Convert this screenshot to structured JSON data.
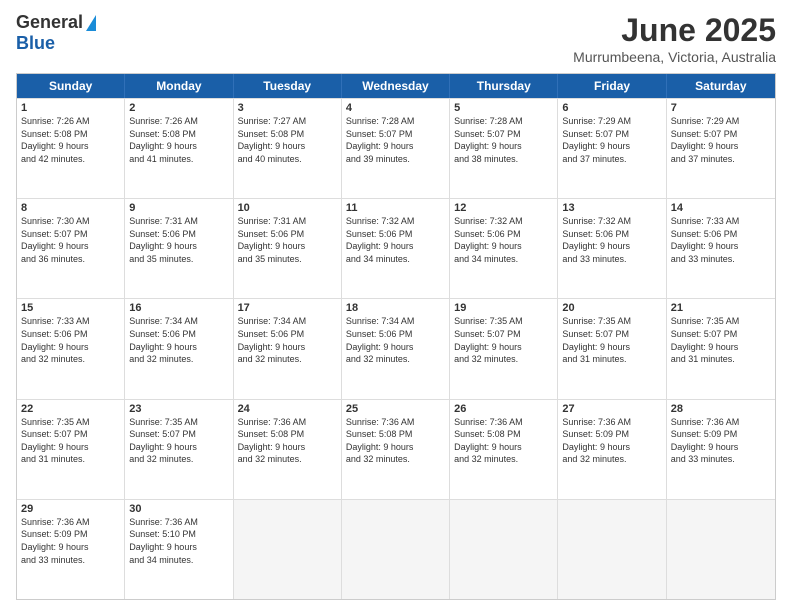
{
  "header": {
    "logo_general": "General",
    "logo_blue": "Blue",
    "title": "June 2025",
    "subtitle": "Murrumbeena, Victoria, Australia"
  },
  "calendar": {
    "days": [
      "Sunday",
      "Monday",
      "Tuesday",
      "Wednesday",
      "Thursday",
      "Friday",
      "Saturday"
    ],
    "rows": [
      [
        {
          "num": "1",
          "info": "Sunrise: 7:26 AM\nSunset: 5:08 PM\nDaylight: 9 hours\nand 42 minutes."
        },
        {
          "num": "2",
          "info": "Sunrise: 7:26 AM\nSunset: 5:08 PM\nDaylight: 9 hours\nand 41 minutes."
        },
        {
          "num": "3",
          "info": "Sunrise: 7:27 AM\nSunset: 5:08 PM\nDaylight: 9 hours\nand 40 minutes."
        },
        {
          "num": "4",
          "info": "Sunrise: 7:28 AM\nSunset: 5:07 PM\nDaylight: 9 hours\nand 39 minutes."
        },
        {
          "num": "5",
          "info": "Sunrise: 7:28 AM\nSunset: 5:07 PM\nDaylight: 9 hours\nand 38 minutes."
        },
        {
          "num": "6",
          "info": "Sunrise: 7:29 AM\nSunset: 5:07 PM\nDaylight: 9 hours\nand 37 minutes."
        },
        {
          "num": "7",
          "info": "Sunrise: 7:29 AM\nSunset: 5:07 PM\nDaylight: 9 hours\nand 37 minutes."
        }
      ],
      [
        {
          "num": "8",
          "info": "Sunrise: 7:30 AM\nSunset: 5:07 PM\nDaylight: 9 hours\nand 36 minutes."
        },
        {
          "num": "9",
          "info": "Sunrise: 7:31 AM\nSunset: 5:06 PM\nDaylight: 9 hours\nand 35 minutes."
        },
        {
          "num": "10",
          "info": "Sunrise: 7:31 AM\nSunset: 5:06 PM\nDaylight: 9 hours\nand 35 minutes."
        },
        {
          "num": "11",
          "info": "Sunrise: 7:32 AM\nSunset: 5:06 PM\nDaylight: 9 hours\nand 34 minutes."
        },
        {
          "num": "12",
          "info": "Sunrise: 7:32 AM\nSunset: 5:06 PM\nDaylight: 9 hours\nand 34 minutes."
        },
        {
          "num": "13",
          "info": "Sunrise: 7:32 AM\nSunset: 5:06 PM\nDaylight: 9 hours\nand 33 minutes."
        },
        {
          "num": "14",
          "info": "Sunrise: 7:33 AM\nSunset: 5:06 PM\nDaylight: 9 hours\nand 33 minutes."
        }
      ],
      [
        {
          "num": "15",
          "info": "Sunrise: 7:33 AM\nSunset: 5:06 PM\nDaylight: 9 hours\nand 32 minutes."
        },
        {
          "num": "16",
          "info": "Sunrise: 7:34 AM\nSunset: 5:06 PM\nDaylight: 9 hours\nand 32 minutes."
        },
        {
          "num": "17",
          "info": "Sunrise: 7:34 AM\nSunset: 5:06 PM\nDaylight: 9 hours\nand 32 minutes."
        },
        {
          "num": "18",
          "info": "Sunrise: 7:34 AM\nSunset: 5:06 PM\nDaylight: 9 hours\nand 32 minutes."
        },
        {
          "num": "19",
          "info": "Sunrise: 7:35 AM\nSunset: 5:07 PM\nDaylight: 9 hours\nand 32 minutes."
        },
        {
          "num": "20",
          "info": "Sunrise: 7:35 AM\nSunset: 5:07 PM\nDaylight: 9 hours\nand 31 minutes."
        },
        {
          "num": "21",
          "info": "Sunrise: 7:35 AM\nSunset: 5:07 PM\nDaylight: 9 hours\nand 31 minutes."
        }
      ],
      [
        {
          "num": "22",
          "info": "Sunrise: 7:35 AM\nSunset: 5:07 PM\nDaylight: 9 hours\nand 31 minutes."
        },
        {
          "num": "23",
          "info": "Sunrise: 7:35 AM\nSunset: 5:07 PM\nDaylight: 9 hours\nand 32 minutes."
        },
        {
          "num": "24",
          "info": "Sunrise: 7:36 AM\nSunset: 5:08 PM\nDaylight: 9 hours\nand 32 minutes."
        },
        {
          "num": "25",
          "info": "Sunrise: 7:36 AM\nSunset: 5:08 PM\nDaylight: 9 hours\nand 32 minutes."
        },
        {
          "num": "26",
          "info": "Sunrise: 7:36 AM\nSunset: 5:08 PM\nDaylight: 9 hours\nand 32 minutes."
        },
        {
          "num": "27",
          "info": "Sunrise: 7:36 AM\nSunset: 5:09 PM\nDaylight: 9 hours\nand 32 minutes."
        },
        {
          "num": "28",
          "info": "Sunrise: 7:36 AM\nSunset: 5:09 PM\nDaylight: 9 hours\nand 33 minutes."
        }
      ],
      [
        {
          "num": "29",
          "info": "Sunrise: 7:36 AM\nSunset: 5:09 PM\nDaylight: 9 hours\nand 33 minutes."
        },
        {
          "num": "30",
          "info": "Sunrise: 7:36 AM\nSunset: 5:10 PM\nDaylight: 9 hours\nand 34 minutes."
        },
        {
          "num": "",
          "info": ""
        },
        {
          "num": "",
          "info": ""
        },
        {
          "num": "",
          "info": ""
        },
        {
          "num": "",
          "info": ""
        },
        {
          "num": "",
          "info": ""
        }
      ]
    ]
  }
}
